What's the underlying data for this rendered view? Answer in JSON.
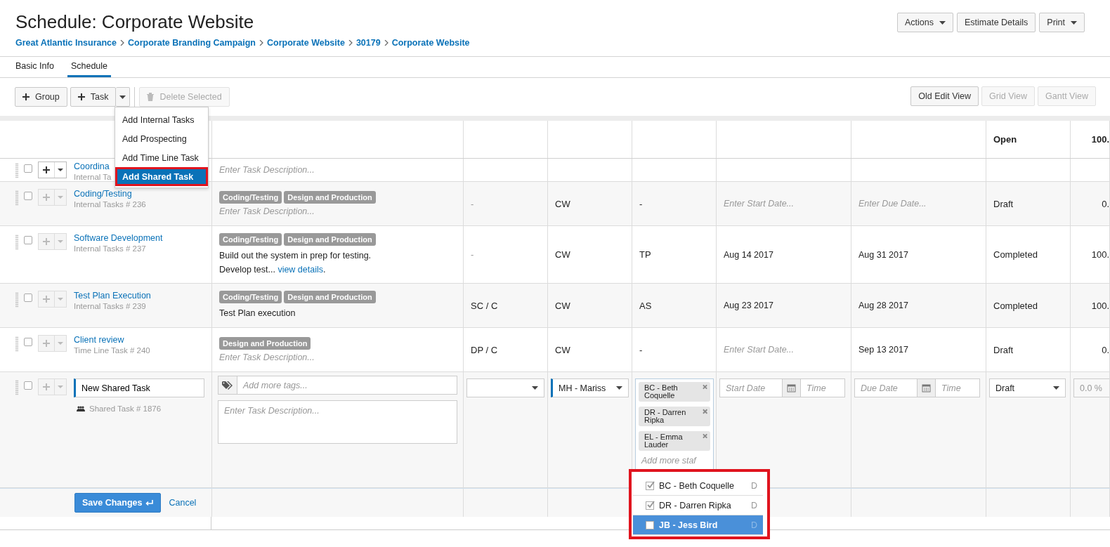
{
  "page_title": "Schedule: Corporate Website",
  "breadcrumb": [
    {
      "label": "Great Atlantic Insurance"
    },
    {
      "label": "Corporate Branding Campaign"
    },
    {
      "label": "Corporate Website"
    },
    {
      "label": "30179"
    },
    {
      "label": "Corporate Website"
    }
  ],
  "header_buttons": [
    {
      "label": "Actions",
      "kind": "dropdown"
    },
    {
      "label": "Estimate Details",
      "kind": "plain"
    },
    {
      "label": "Print",
      "kind": "dropdown"
    }
  ],
  "tabs": [
    {
      "label": "Basic Info",
      "selected": false
    },
    {
      "label": "Schedule",
      "selected": true
    }
  ],
  "toolbar": {
    "group_button": "Group",
    "task_button": "Task",
    "delete_button": {
      "label": "Delete Selected",
      "disabled": true
    }
  },
  "view_buttons": [
    {
      "label": "Old Edit View",
      "disabled": false
    },
    {
      "label": "Grid View",
      "disabled": true
    },
    {
      "label": "Gantt View",
      "disabled": true
    }
  ],
  "task_menu": [
    {
      "label": "Add Internal Tasks",
      "selected": false
    },
    {
      "label": "Add Prospecting",
      "selected": false
    },
    {
      "label": "Add Time Line Task",
      "selected": false
    },
    {
      "label": "Add Shared Task",
      "selected": true
    }
  ],
  "table": {
    "header": {
      "column_8": "Open",
      "column_9": "100."
    },
    "rows": [
      {
        "title": "Coordina",
        "subtitle": "Internal Ta",
        "checked": false,
        "add_enabled": true,
        "tags": [],
        "description": {
          "text": "Enter Task Description...",
          "empty": true
        },
        "column_3": null,
        "column_4": null,
        "column_5": null,
        "start_date": null,
        "due_date": null,
        "status": null,
        "percent": null
      },
      {
        "title": "Coding/Testing",
        "subtitle": "Internal Tasks # 236",
        "checked": false,
        "add_enabled": false,
        "tags": [
          "Coding/Testing",
          "Design and Production"
        ],
        "description": {
          "text": "Enter Task Description...",
          "empty": true
        },
        "column_3": "-",
        "column_4": "CW",
        "column_5": "-",
        "start_date": {
          "text": "Enter Start Date...",
          "empty": true
        },
        "due_date": {
          "text": "Enter Due Date...",
          "empty": true
        },
        "status": "Draft",
        "percent": "0."
      },
      {
        "title": "Software Development",
        "subtitle": "Internal Tasks # 237",
        "checked": false,
        "add_enabled": false,
        "tags": [
          "Coding/Testing",
          "Design and Production"
        ],
        "description": {
          "text": "Build out the system in prep for testing. Develop test...",
          "empty": false,
          "link": "view details",
          "after": "."
        },
        "column_3": "-",
        "column_4": "CW",
        "column_5": "TP",
        "start_date": {
          "text": "Aug 14 2017",
          "empty": false
        },
        "due_date": {
          "text": "Aug 31 2017",
          "empty": false
        },
        "status": "Completed",
        "percent": "100."
      },
      {
        "title": "Test Plan Execution",
        "subtitle": "Internal Tasks # 239",
        "checked": false,
        "add_enabled": false,
        "tags": [
          "Coding/Testing",
          "Design and Production"
        ],
        "description": {
          "text": "Test Plan execution",
          "empty": false
        },
        "column_3": "SC / C",
        "column_4": "CW",
        "column_5": "AS",
        "start_date": {
          "text": "Aug 23 2017",
          "empty": false
        },
        "due_date": {
          "text": "Aug 28 2017",
          "empty": false
        },
        "status": "Completed",
        "percent": "100."
      },
      {
        "title": "Client review",
        "subtitle": "Time Line Task # 240",
        "checked": false,
        "add_enabled": false,
        "tags": [
          "Design and Production"
        ],
        "description": {
          "text": "Enter Task Description...",
          "empty": true
        },
        "column_3": "DP / C",
        "column_4": "CW",
        "column_5": "-",
        "start_date": {
          "text": "Enter Start Date...",
          "empty": true
        },
        "due_date": {
          "text": "Sep 13 2017",
          "empty": false
        },
        "status": "Draft",
        "percent": "0."
      }
    ],
    "edit_row": {
      "checked": false,
      "name_value": "New Shared Task",
      "subtitle": "Shared Task # 1876",
      "tags_placeholder": "Add more tags...",
      "description_placeholder": "Enter Task Description...",
      "assignee": "MH - Mariss",
      "staff": [
        {
          "label": "BC - Beth Coquelle"
        },
        {
          "label": "DR - Darren Ripka"
        },
        {
          "label": "EL - Emma Lauder"
        }
      ],
      "staff_placeholder": "Add more staf",
      "start_date_placeholder": "Start Date",
      "start_time_placeholder": "Time",
      "due_date_placeholder": "Due Date",
      "due_time_placeholder": "Time",
      "status": "Draft",
      "percent_placeholder": "0.0 %"
    },
    "save_button": "Save Changes",
    "cancel_link": "Cancel"
  },
  "staff_dropdown": [
    {
      "label": "BC - Beth Coquelle",
      "code": "D",
      "checked": true,
      "selected": false
    },
    {
      "label": "DR - Darren Ripka",
      "code": "D",
      "checked": true,
      "selected": false
    },
    {
      "label": "JB - Jess Bird",
      "code": "D",
      "checked": false,
      "selected": true
    }
  ]
}
